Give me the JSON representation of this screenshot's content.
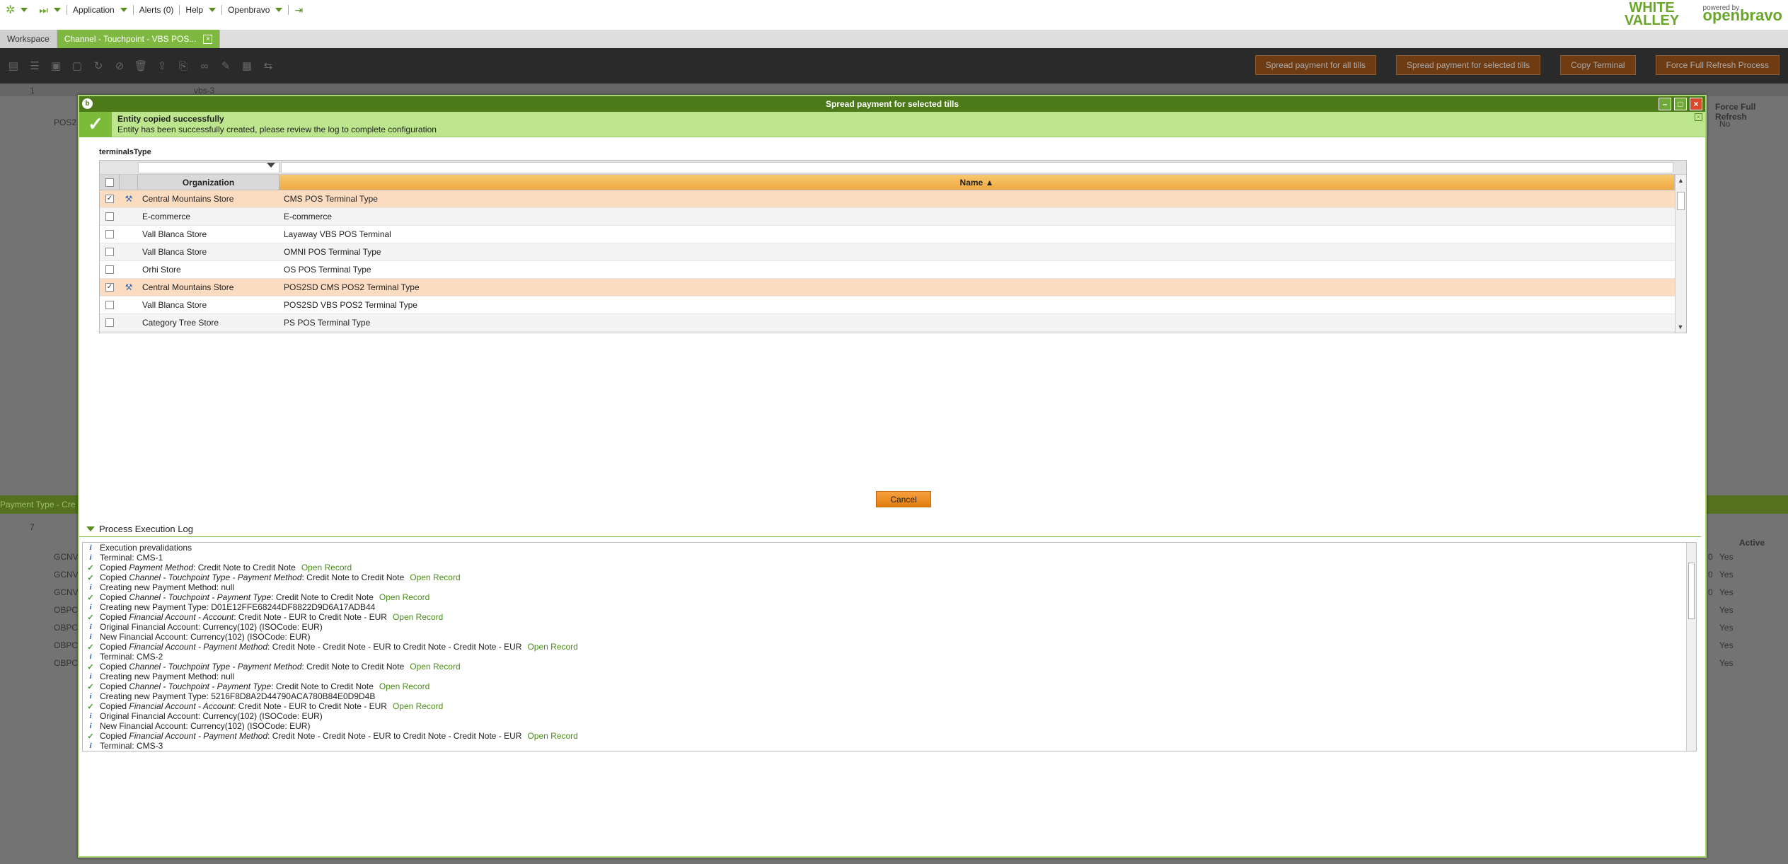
{
  "topbar": {
    "application": "Application",
    "alerts": "Alerts (0)",
    "help": "Help",
    "user": "Openbravo",
    "brand_white_valley": "WHITE VALLEY",
    "brand_powered": "powered by",
    "brand_openbravo": "openbravo"
  },
  "tabs": [
    {
      "label": "Workspace"
    },
    {
      "label": "Channel - Touchpoint - VBS POS..."
    }
  ],
  "toolbar_buttons": {
    "spread_all": "Spread payment for all tills",
    "spread_selected": "Spread payment for selected tills",
    "copy_terminal": "Copy Terminal",
    "force_refresh": "Force Full Refresh Process"
  },
  "background": {
    "filter_value": "vbs-3",
    "row_label": "POS2",
    "force_refresh_col": "Force Full Refresh",
    "force_refresh_val": "No",
    "subtab": "Payment Type - Cre",
    "active_col": "Active",
    "row_codes": [
      "GCNV",
      "GCNV",
      "GCNV",
      "OBPC",
      "OBPC",
      "OBPC",
      "OBPC"
    ],
    "row_nums": [
      "0",
      "0",
      "0",
      "",
      "",
      "",
      ""
    ],
    "active_vals": [
      "Yes",
      "Yes",
      "Yes",
      "Yes",
      "Yes",
      "Yes",
      "Yes"
    ],
    "count_label": "7",
    "one_label": "1"
  },
  "modal": {
    "title": "Spread payment for selected tills",
    "message_title": "Entity copied successfully",
    "message_text": "Entity has been successfully created, please review the log to complete configuration",
    "field_label": "terminalsType",
    "col_org": "Organization",
    "col_name": "Name ▲",
    "rows": [
      {
        "org": "Central Mountains Store",
        "name": "CMS POS Terminal Type",
        "checked": "✓"
      },
      {
        "org": "E-commerce",
        "name": "E-commerce",
        "checked": ""
      },
      {
        "org": "Vall Blanca Store",
        "name": "Layaway VBS POS Terminal",
        "checked": ""
      },
      {
        "org": "Vall Blanca Store",
        "name": "OMNI POS Terminal Type",
        "checked": ""
      },
      {
        "org": "Orhi Store",
        "name": "OS POS Terminal Type",
        "checked": ""
      },
      {
        "org": "Central Mountains Store",
        "name": "POS2SD CMS POS2 Terminal Type",
        "checked": "✓"
      },
      {
        "org": "Vall Blanca Store",
        "name": "POS2SD VBS POS2 Terminal Type",
        "checked": ""
      },
      {
        "org": "Category Tree Store",
        "name": "PS POS Terminal Type",
        "checked": ""
      }
    ],
    "cancel": "Cancel",
    "log_title": "Process Execution Log",
    "log_link": "Open Record",
    "log": [
      {
        "icon": "i",
        "text": "Execution prevalidations"
      },
      {
        "icon": "i",
        "text": "Terminal: CMS-1"
      },
      {
        "icon": "c",
        "pre": "Copied ",
        "em": "Payment Method",
        "text": ": Credit Note to Credit Note"
      },
      {
        "icon": "c",
        "pre": "Copied ",
        "em": "Channel - Touchpoint Type - Payment Method",
        "text": ": Credit Note to Credit Note"
      },
      {
        "icon": "i",
        "text": "Creating new Payment Method: null"
      },
      {
        "icon": "c",
        "pre": "Copied ",
        "em": "Channel - Touchpoint - Payment Type",
        "text": ": Credit Note to Credit Note"
      },
      {
        "icon": "i",
        "text": "Creating new Payment Type: D01E12FFE68244DF8822D9D6A17ADB44"
      },
      {
        "icon": "c",
        "pre": "Copied ",
        "em": "Financial Account - Account",
        "text": ": Credit Note - EUR to Credit Note - EUR"
      },
      {
        "icon": "i",
        "text": "Original Financial Account: Currency(102) (ISOCode: EUR)"
      },
      {
        "icon": "i",
        "text": "New Financial Account: Currency(102) (ISOCode: EUR)"
      },
      {
        "icon": "c",
        "pre": "Copied ",
        "em": "Financial Account - Payment Method",
        "text": ": Credit Note - Credit Note - EUR to Credit Note - Credit Note - EUR"
      },
      {
        "icon": "i",
        "text": "Terminal: CMS-2"
      },
      {
        "icon": "c",
        "pre": "Copied ",
        "em": "Channel - Touchpoint Type - Payment Method",
        "text": ": Credit Note to Credit Note"
      },
      {
        "icon": "i",
        "text": "Creating new Payment Method: null"
      },
      {
        "icon": "c",
        "pre": "Copied ",
        "em": "Channel - Touchpoint - Payment Type",
        "text": ": Credit Note to Credit Note"
      },
      {
        "icon": "i",
        "text": "Creating new Payment Type: 5216F8D8A2D44790ACA780B84E0D9D4B"
      },
      {
        "icon": "c",
        "pre": "Copied ",
        "em": "Financial Account - Account",
        "text": ": Credit Note - EUR to Credit Note - EUR"
      },
      {
        "icon": "i",
        "text": "Original Financial Account: Currency(102) (ISOCode: EUR)"
      },
      {
        "icon": "i",
        "text": "New Financial Account: Currency(102) (ISOCode: EUR)"
      },
      {
        "icon": "c",
        "pre": "Copied ",
        "em": "Financial Account - Payment Method",
        "text": ": Credit Note - Credit Note - EUR to Credit Note - Credit Note - EUR"
      },
      {
        "icon": "i",
        "text": "Terminal: CMS-3"
      }
    ],
    "log_has_link": [
      false,
      false,
      true,
      true,
      false,
      true,
      false,
      true,
      false,
      false,
      true,
      false,
      true,
      false,
      true,
      false,
      true,
      false,
      false,
      true,
      false
    ]
  }
}
